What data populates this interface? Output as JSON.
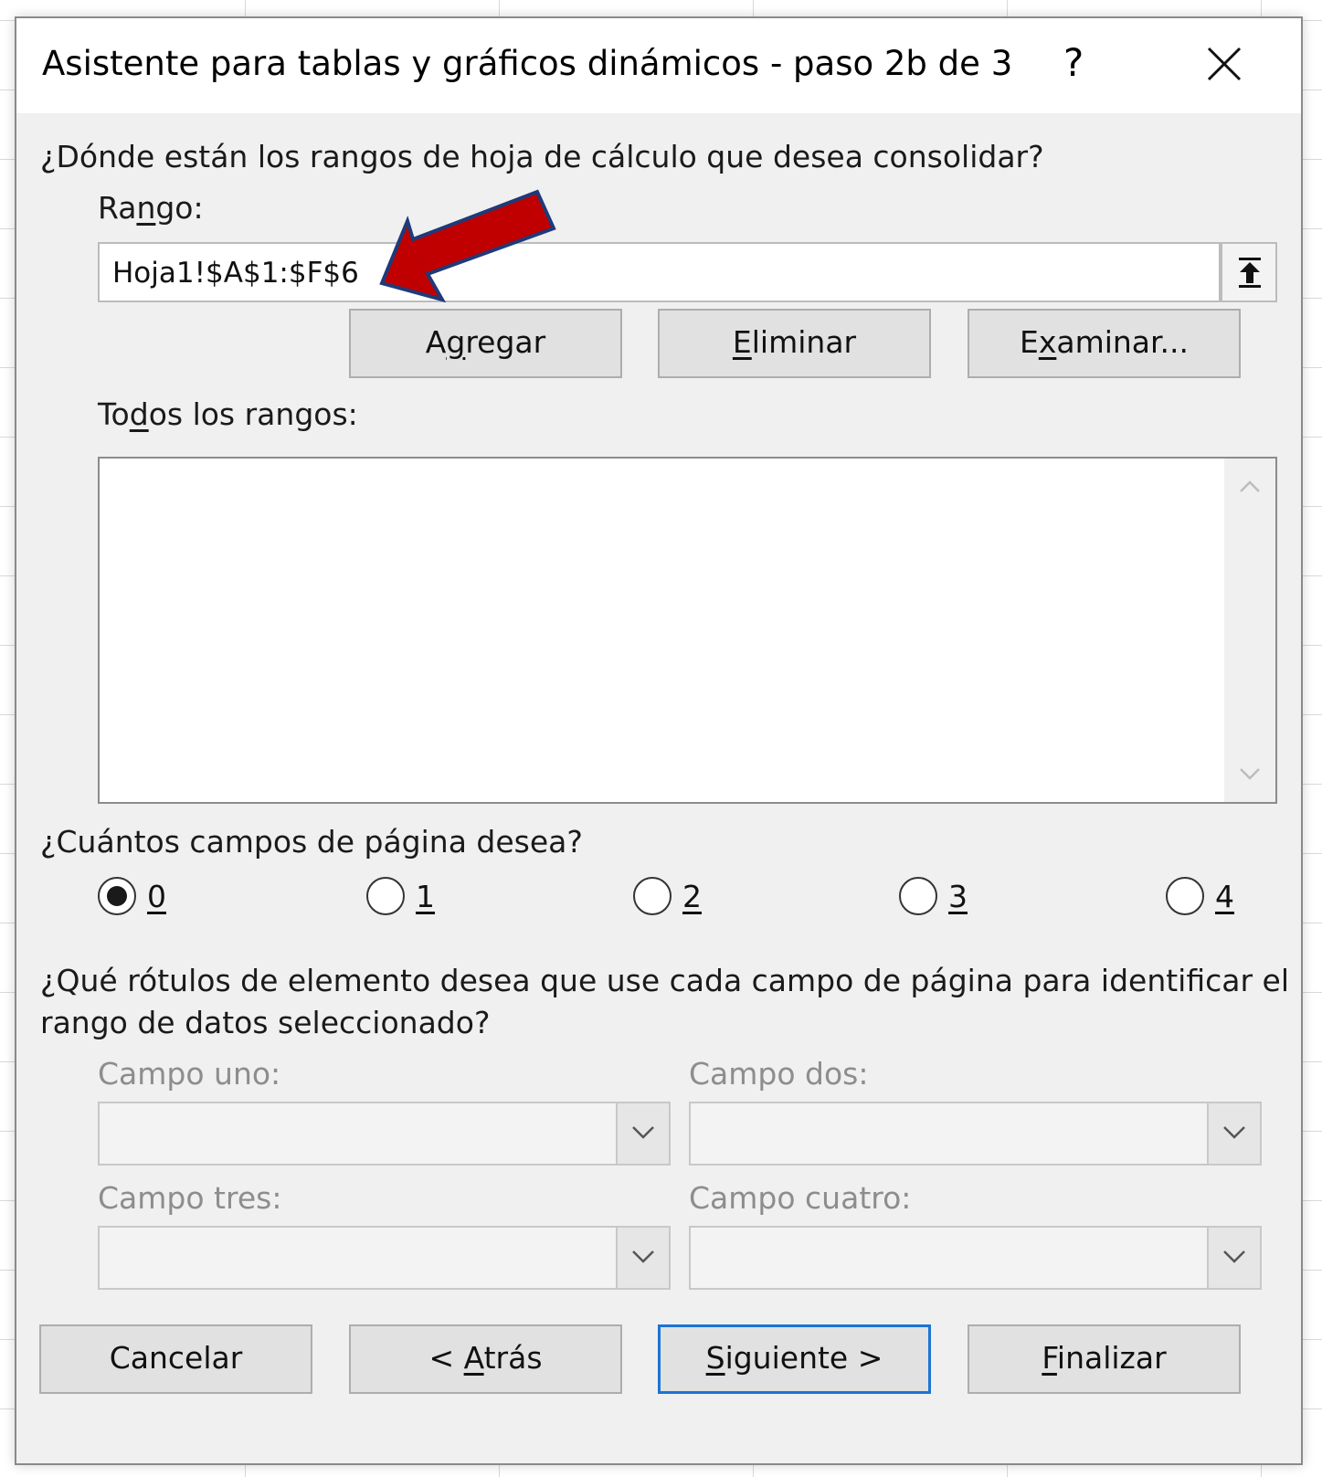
{
  "dialog": {
    "title": "Asistente para tablas y gráficos dinámicos - paso 2b de 3",
    "help_label": "?",
    "question_ranges": "¿Dónde están los rangos de hoja de cálculo que desea consolidar?",
    "rango_label": {
      "pre": "Ra",
      "key": "n",
      "post": "go:"
    },
    "rango_value": "Hoja1!$A$1:$F$6",
    "buttons": {
      "agregar": {
        "pre": "A",
        "key": "g",
        "post": "regar"
      },
      "eliminar": {
        "pre": "",
        "key": "E",
        "post": "liminar"
      },
      "examinar": {
        "pre": "E",
        "key": "x",
        "post": "aminar..."
      }
    },
    "todos_label": {
      "pre": "To",
      "key": "d",
      "post": "os los rangos:"
    },
    "question_pages": "¿Cuántos campos de página desea?",
    "page_options": [
      "0",
      "1",
      "2",
      "3",
      "4"
    ],
    "page_selected": "0",
    "question_labels_1": "¿Qué rótulos de elemento desea que use cada campo de página para identificar el",
    "question_labels_2": "rango de datos seleccionado?",
    "campo_uno": "Campo uno:",
    "campo_dos": "Campo dos:",
    "campo_tres": "Campo tres:",
    "campo_cuatro": "Campo cuatro:",
    "footer": {
      "cancelar": "Cancelar",
      "atras": {
        "pre": "< ",
        "key": "A",
        "post": "trás"
      },
      "siguiente": {
        "pre": "",
        "key": "S",
        "post": "iguiente >"
      },
      "finalizar": {
        "pre": "",
        "key": "F",
        "post": "inalizar"
      }
    }
  },
  "colors": {
    "annotation_arrow_fill": "#c00000",
    "annotation_arrow_stroke": "#1f3a7a",
    "default_button_border": "#1c74d4"
  },
  "icons": {
    "collapse": "collapse-dialog-icon",
    "close": "close-icon",
    "dropdown": "chevron-down-icon"
  }
}
